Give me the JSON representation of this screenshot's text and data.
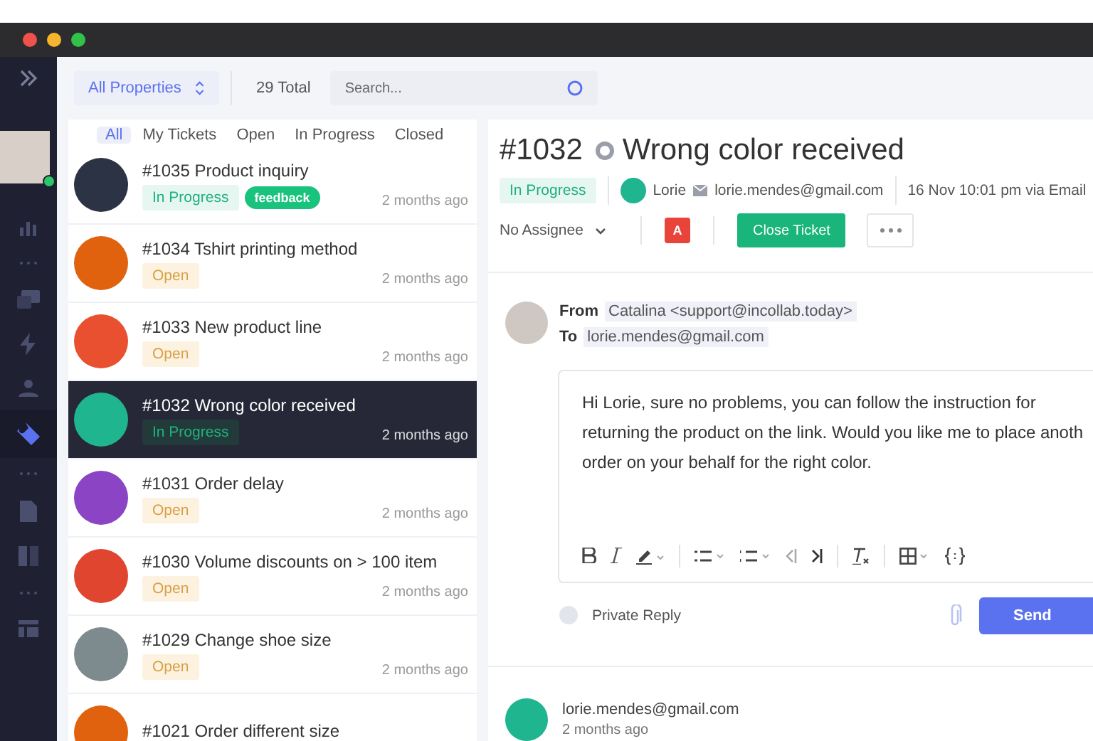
{
  "toolbar": {
    "property_filter": "All Properties",
    "total": "29 Total",
    "search": {
      "placeholder": "Search..."
    }
  },
  "tabs": [
    {
      "label": "All",
      "selected": true
    },
    {
      "label": "My Tickets",
      "selected": false
    },
    {
      "label": "Open",
      "selected": false
    },
    {
      "label": "In Progress",
      "selected": false
    },
    {
      "label": "Closed",
      "selected": false
    }
  ],
  "tickets": [
    {
      "title": "#1035 Product inquiry",
      "status": {
        "label": "In Progress",
        "kind": "progress"
      },
      "tag": "feedback",
      "time": "2 months ago",
      "color": "#2c3344",
      "selected": false
    },
    {
      "title": "#1034 Tshirt printing method",
      "status": {
        "label": "Open",
        "kind": "open"
      },
      "time": "2 months ago",
      "color": "#e0620f",
      "selected": false
    },
    {
      "title": "#1033 New product line",
      "status": {
        "label": "Open",
        "kind": "open"
      },
      "time": "2 months ago",
      "color": "#e8502f",
      "selected": false
    },
    {
      "title": "#1032 Wrong color received",
      "status": {
        "label": "In Progress",
        "kind": "progress"
      },
      "time": "2 months ago",
      "color": "#1fb58f",
      "selected": true
    },
    {
      "title": "#1031 Order delay",
      "status": {
        "label": "Open",
        "kind": "open"
      },
      "time": "2 months ago",
      "color": "#8a44c4",
      "selected": false
    },
    {
      "title": "#1030 Volume discounts on > 100 item",
      "status": {
        "label": "Open",
        "kind": "open"
      },
      "time": "2 months ago",
      "color": "#e0452f",
      "selected": false
    },
    {
      "title": "#1029 Change shoe size",
      "status": {
        "label": "Open",
        "kind": "open"
      },
      "time": "2 months ago",
      "color": "#7d8a8e",
      "selected": false
    },
    {
      "title": "#1021 Order different size",
      "color": "#e0620f",
      "selected": false
    }
  ],
  "detail": {
    "number": "#1032",
    "title": "Wrong color received",
    "status": {
      "label": "In Progress",
      "kind": "progress"
    },
    "customer": "Lorie",
    "email": "lorie.mendes@gmail.com",
    "received": "16 Nov 10:01 pm via Email",
    "assignee": "No Assignee",
    "agent_initial": "A",
    "close_button": "Close Ticket",
    "reply": {
      "from_label": "From",
      "from": "Catalina <support@incollab.today>",
      "to_label": "To",
      "to": "lorie.mendes@gmail.com",
      "lines": [
        "Hi Lorie, sure no problems, you can follow the instruction for",
        "returning the product on the link. Would you like me to place anoth",
        "order on your behalf for the right color."
      ],
      "private_label": "Private Reply",
      "private": false,
      "send": "Send"
    },
    "message": {
      "sender": "lorie.mendes@gmail.com",
      "time": "2 months ago"
    }
  }
}
